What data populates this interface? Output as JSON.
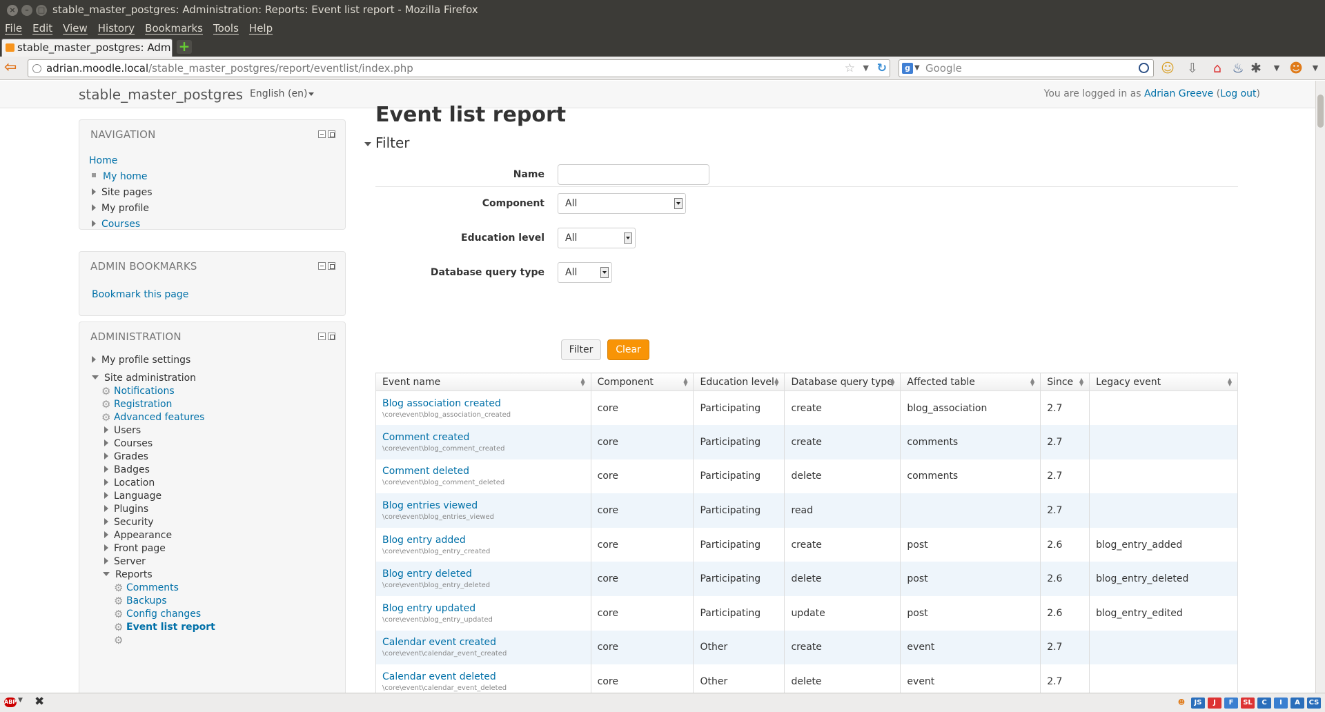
{
  "window": {
    "title": "stable_master_postgres: Administration: Reports: Event list report - Mozilla Firefox"
  },
  "browser": {
    "menu": [
      "File",
      "Edit",
      "View",
      "History",
      "Bookmarks",
      "Tools",
      "Help"
    ],
    "tab_title": "stable_master_postgres: Adm...",
    "url_host": "adrian.moodle.local",
    "url_path": "/stable_master_postgres/report/eventlist/index.php",
    "search_placeholder": "Google"
  },
  "header": {
    "site_name": "stable_master_postgres",
    "language": "English (en)",
    "login_prefix": "You are logged in as ",
    "user_name": "Adrian Greeve",
    "logout_label": "Log out"
  },
  "navigation": {
    "title": "NAVIGATION",
    "home": "Home",
    "items": [
      "My home",
      "Site pages",
      "My profile",
      "Courses"
    ]
  },
  "admin_bookmarks": {
    "title": "ADMIN BOOKMARKS",
    "link": "Bookmark this page"
  },
  "administration": {
    "title": "ADMINISTRATION",
    "profile_settings": "My profile settings",
    "site_admin": "Site administration",
    "gear_items": [
      "Notifications",
      "Registration",
      "Advanced features"
    ],
    "collapsed_items": [
      "Users",
      "Courses",
      "Grades",
      "Badges",
      "Location",
      "Language",
      "Plugins",
      "Security",
      "Appearance",
      "Front page",
      "Server"
    ],
    "reports": "Reports",
    "report_items": [
      "Comments",
      "Backups",
      "Config changes",
      "Event list report"
    ]
  },
  "main": {
    "heading": "Event list report",
    "filter_title": "Filter",
    "labels": {
      "name": "Name",
      "component": "Component",
      "education_level": "Education level",
      "query_type": "Database query type"
    },
    "selects": {
      "component": "All",
      "education_level": "All",
      "query_type": "All"
    },
    "name_value": "",
    "filter_button": "Filter",
    "clear_button": "Clear"
  },
  "table": {
    "columns": [
      "Event name",
      "Component",
      "Education level",
      "Database query type",
      "Affected table",
      "Since",
      "Legacy event"
    ],
    "rows": [
      {
        "name": "Blog association created",
        "class": "\\core\\event\\blog_association_created",
        "component": "core",
        "level": "Participating",
        "query": "create",
        "table": "blog_association",
        "since": "2.7",
        "legacy": ""
      },
      {
        "name": "Comment created",
        "class": "\\core\\event\\blog_comment_created",
        "component": "core",
        "level": "Participating",
        "query": "create",
        "table": "comments",
        "since": "2.7",
        "legacy": ""
      },
      {
        "name": "Comment deleted",
        "class": "\\core\\event\\blog_comment_deleted",
        "component": "core",
        "level": "Participating",
        "query": "delete",
        "table": "comments",
        "since": "2.7",
        "legacy": ""
      },
      {
        "name": "Blog entries viewed",
        "class": "\\core\\event\\blog_entries_viewed",
        "component": "core",
        "level": "Participating",
        "query": "read",
        "table": "",
        "since": "2.7",
        "legacy": ""
      },
      {
        "name": "Blog entry added",
        "class": "\\core\\event\\blog_entry_created",
        "component": "core",
        "level": "Participating",
        "query": "create",
        "table": "post",
        "since": "2.6",
        "legacy": "blog_entry_added"
      },
      {
        "name": "Blog entry deleted",
        "class": "\\core\\event\\blog_entry_deleted",
        "component": "core",
        "level": "Participating",
        "query": "delete",
        "table": "post",
        "since": "2.6",
        "legacy": "blog_entry_deleted"
      },
      {
        "name": "Blog entry updated",
        "class": "\\core\\event\\blog_entry_updated",
        "component": "core",
        "level": "Participating",
        "query": "update",
        "table": "post",
        "since": "2.6",
        "legacy": "blog_entry_edited"
      },
      {
        "name": "Calendar event created",
        "class": "\\core\\event\\calendar_event_created",
        "component": "core",
        "level": "Other",
        "query": "create",
        "table": "event",
        "since": "2.7",
        "legacy": ""
      },
      {
        "name": "Calendar event deleted",
        "class": "\\core\\event\\calendar_event_deleted",
        "component": "core",
        "level": "Other",
        "query": "delete",
        "table": "event",
        "since": "2.7",
        "legacy": ""
      }
    ]
  },
  "statusbar": {
    "addon_icons": [
      "JS",
      "J",
      "F",
      "SL",
      "C",
      "I",
      "A",
      "CS"
    ],
    "addon_colors": [
      "#2a6ebb",
      "#d33",
      "#3a7fd0",
      "#d33",
      "#2a6ebb",
      "#3a7fd0",
      "#2a6ebb",
      "#2a6ebb"
    ]
  }
}
